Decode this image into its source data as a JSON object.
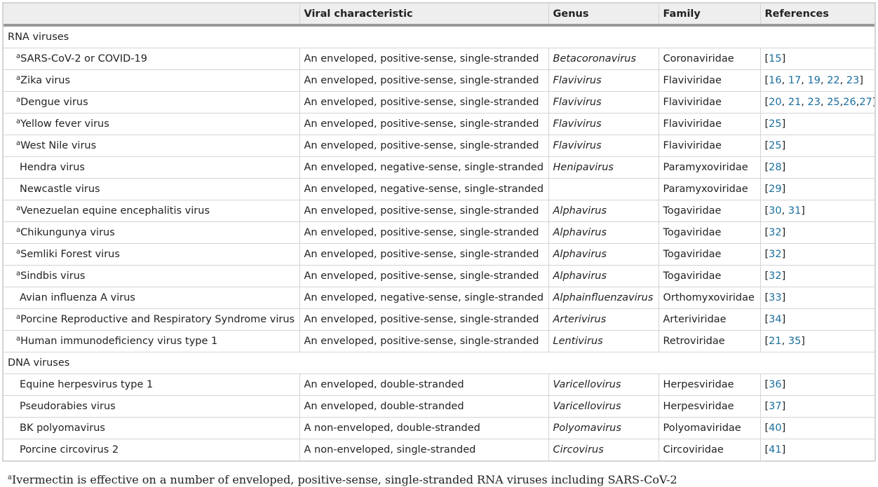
{
  "header": {
    "col_virus": "",
    "col_characteristic": "Viral characteristic",
    "col_genus": "Genus",
    "col_family": "Family",
    "col_references": "References"
  },
  "footnote_marker": "a",
  "sections": [
    {
      "title": "RNA viruses",
      "rows": [
        {
          "marked": true,
          "virus": "SARS-CoV-2 or COVID-19",
          "characteristic": "An enveloped, positive-sense, single-stranded",
          "genus": "Betacoronavirus",
          "family": "Coronaviridae",
          "refs": [
            "15"
          ]
        },
        {
          "marked": true,
          "virus": "Zika virus",
          "characteristic": "An enveloped, positive-sense, single-stranded",
          "genus": "Flavivirus",
          "family": "Flaviviridae",
          "refs": [
            "16",
            "17",
            "19",
            "22",
            "23"
          ]
        },
        {
          "marked": true,
          "virus": "Dengue virus",
          "characteristic": "An enveloped, positive-sense, single-stranded",
          "genus": "Flavivirus",
          "family": "Flaviviridae",
          "refs": [
            "20",
            "21",
            "23",
            "25",
            "26",
            "27"
          ]
        },
        {
          "marked": true,
          "virus": "Yellow fever virus",
          "characteristic": "An enveloped, positive-sense, single-stranded",
          "genus": "Flavivirus",
          "family": "Flaviviridae",
          "refs": [
            "25"
          ]
        },
        {
          "marked": true,
          "virus": "West Nile virus",
          "characteristic": "An enveloped, positive-sense, single-stranded",
          "genus": "Flavivirus",
          "family": "Flaviviridae",
          "refs": [
            "25"
          ]
        },
        {
          "marked": false,
          "virus": "Hendra virus",
          "characteristic": "An enveloped, negative-sense, single-stranded",
          "genus": "Henipavirus",
          "family": "Paramyxoviridae",
          "refs": [
            "28"
          ]
        },
        {
          "marked": false,
          "virus": "Newcastle virus",
          "characteristic": "An enveloped, negative-sense, single-stranded",
          "genus": "",
          "family": "Paramyxoviridae",
          "refs": [
            "29"
          ]
        },
        {
          "marked": true,
          "virus": "Venezuelan equine encephalitis virus",
          "characteristic": "An enveloped, positive-sense, single-stranded",
          "genus": "Alphavirus",
          "family": "Togaviridae",
          "refs": [
            "30",
            "31"
          ]
        },
        {
          "marked": true,
          "virus": "Chikungunya virus",
          "characteristic": "An enveloped, positive-sense, single-stranded",
          "genus": "Alphavirus",
          "family": "Togaviridae",
          "refs": [
            "32"
          ]
        },
        {
          "marked": true,
          "virus": "Semliki Forest virus",
          "characteristic": "An enveloped, positive-sense, single-stranded",
          "genus": "Alphavirus",
          "family": "Togaviridae",
          "refs": [
            "32"
          ]
        },
        {
          "marked": true,
          "virus": "Sindbis virus",
          "characteristic": "An enveloped, positive-sense, single-stranded",
          "genus": "Alphavirus",
          "family": "Togaviridae",
          "refs": [
            "32"
          ]
        },
        {
          "marked": false,
          "virus": "Avian influenza A virus",
          "characteristic": "An enveloped, negative-sense, single-stranded",
          "genus": "Alphainfluenzavirus",
          "family": "Orthomyxoviridae",
          "refs": [
            "33"
          ]
        },
        {
          "marked": true,
          "virus": "Porcine Reproductive and Respiratory Syndrome virus",
          "characteristic": "An enveloped, positive-sense, single-stranded",
          "genus": "Arterivirus",
          "family": "Arteriviridae",
          "refs": [
            "34"
          ]
        },
        {
          "marked": true,
          "virus": "Human immunodeficiency virus type 1",
          "characteristic": "An enveloped, positive-sense, single-stranded",
          "genus": "Lentivirus",
          "family": "Retroviridae",
          "refs": [
            "21",
            "35"
          ]
        }
      ]
    },
    {
      "title": "DNA viruses",
      "rows": [
        {
          "marked": false,
          "virus": "Equine herpesvirus type 1",
          "characteristic": "An enveloped, double-stranded",
          "genus": "Varicellovirus",
          "family": "Herpesviridae",
          "refs": [
            "36"
          ]
        },
        {
          "marked": false,
          "virus": "Pseudorabies virus",
          "characteristic": "An enveloped, double-stranded",
          "genus": "Varicellovirus",
          "family": "Herpesviridae",
          "refs": [
            "37"
          ]
        },
        {
          "marked": false,
          "virus": "BK polyomavirus",
          "characteristic": "A non-enveloped, double-stranded",
          "genus": "Polyomavirus",
          "family": "Polyomaviridae",
          "refs": [
            "40"
          ]
        },
        {
          "marked": false,
          "virus": "Porcine circovirus 2",
          "characteristic": "A non-enveloped, single-stranded",
          "genus": "Circovirus",
          "family": "Circoviridae",
          "refs": [
            "41"
          ]
        }
      ]
    }
  ],
  "footnote": {
    "marker": "a",
    "text": "Ivermectin is effective on a number of enveloped, positive-sense, single-stranded RNA viruses including SARS-CoV-2"
  }
}
